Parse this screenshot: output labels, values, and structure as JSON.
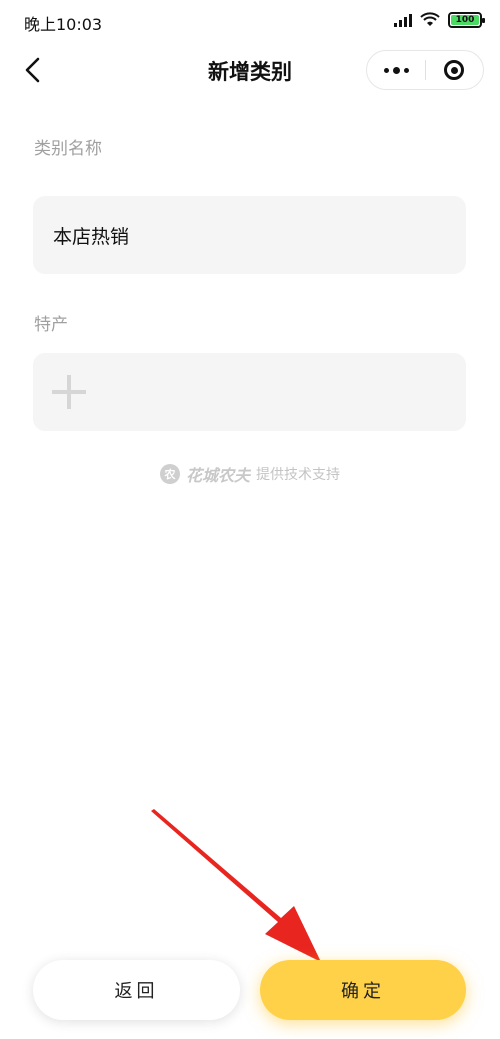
{
  "status_bar": {
    "time": "晚上10:03",
    "battery_level": "100",
    "battery_color": "#4cd964"
  },
  "nav": {
    "title": "新增类别"
  },
  "form": {
    "category_name_label": "类别名称",
    "category_name_value": "本店热销",
    "specialty_label": "特产"
  },
  "footer": {
    "brand": "花城农夫",
    "powered_by": "提供技术支持"
  },
  "buttons": {
    "back_label": "返回",
    "confirm_label": "确定"
  },
  "colors": {
    "accent": "#ffd149",
    "annotation_arrow": "#e8251f"
  }
}
